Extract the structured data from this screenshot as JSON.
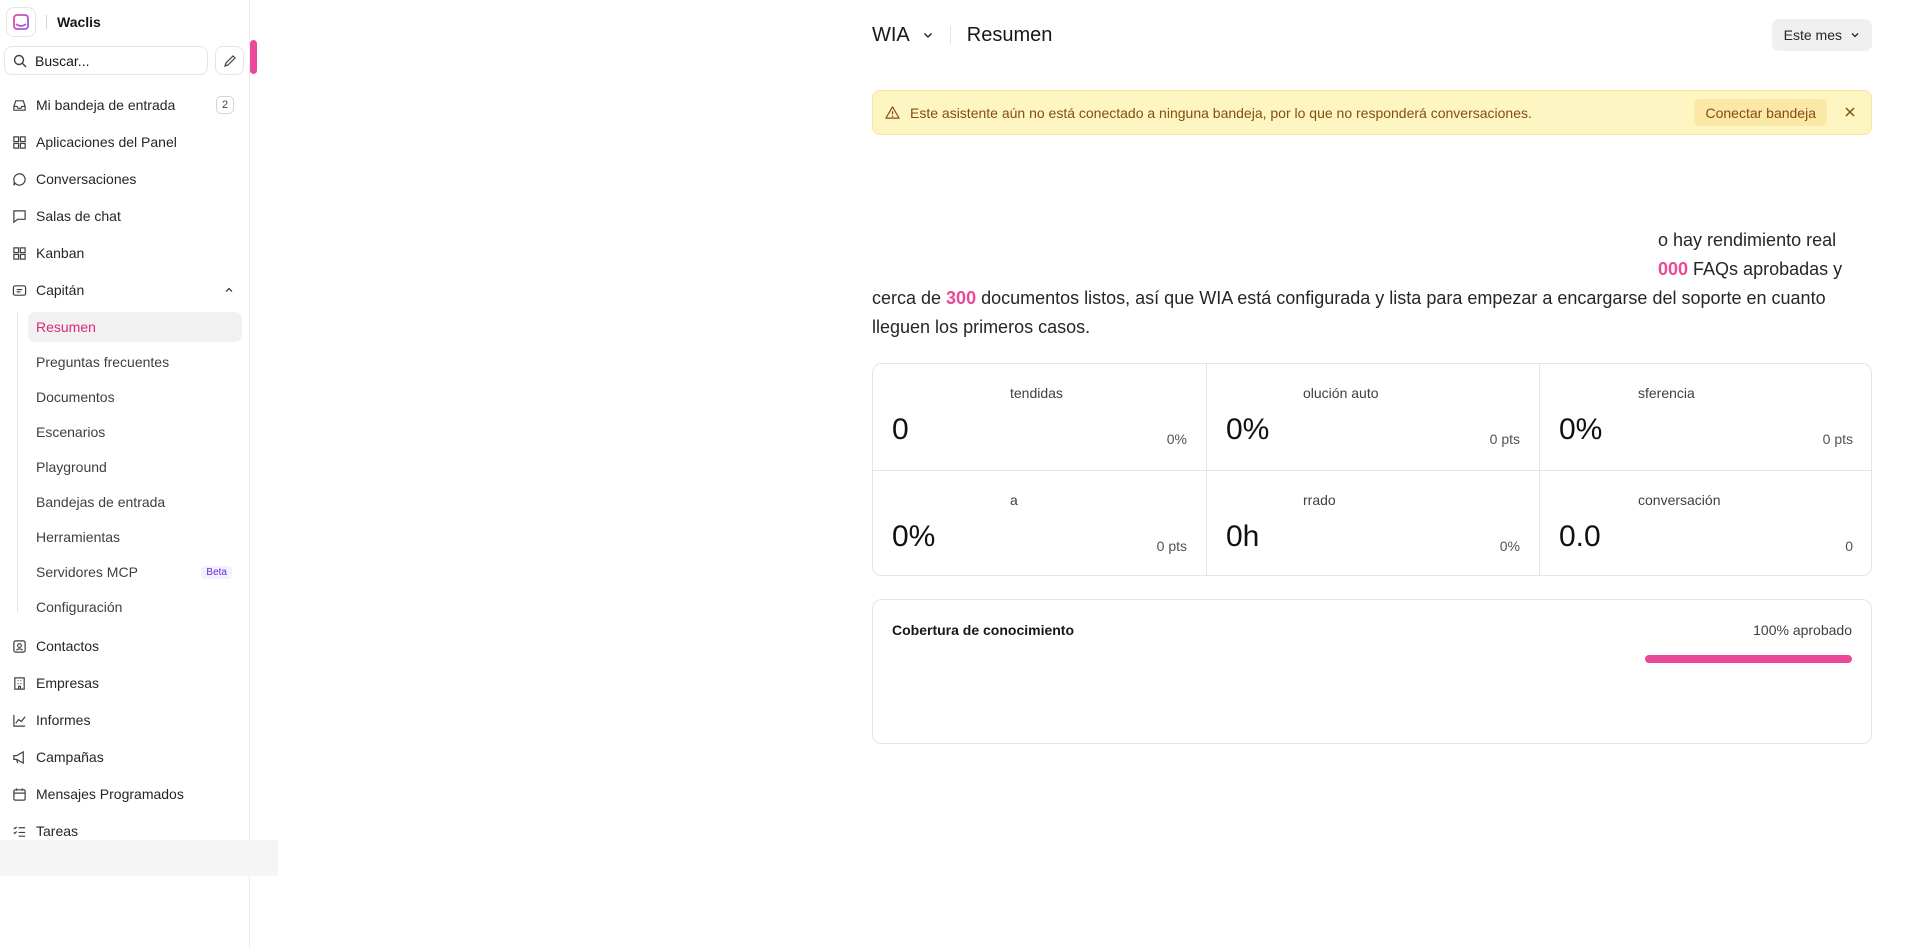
{
  "brand": {
    "name": "Waclis"
  },
  "search": {
    "placeholder": "Buscar..."
  },
  "nav": {
    "inbox": {
      "label": "Mi bandeja de entrada",
      "count": "2"
    },
    "dashboard_apps": "Aplicaciones del Panel",
    "conversations": "Conversaciones",
    "chat_rooms": "Salas de chat",
    "kanban": "Kanban",
    "captain": "Capitán",
    "captain_items": [
      "Resumen",
      "Preguntas frecuentes",
      "Documentos",
      "Escenarios",
      "Playground",
      "Bandejas de entrada",
      "Herramientas",
      "Servidores MCP",
      "Configuración"
    ],
    "beta_label": "Beta",
    "contacts": "Contactos",
    "companies": "Empresas",
    "reports": "Informes",
    "campaigns": "Campañas",
    "scheduled_messages": "Mensajes Programados",
    "tasks": "Tareas"
  },
  "header": {
    "assistant": "WIA",
    "title": "Resumen",
    "period": "Este mes"
  },
  "alert": {
    "text": "Este asistente aún no está conectado a ninguna bandeja, por lo que no responderá conversaciones.",
    "action": "Conectar bandeja"
  },
  "intro": {
    "line1": "o hay rendimiento real",
    "highlight1": "000",
    "line2_rest": " FAQs aprobadas y",
    "line3_start": "cerca de ",
    "highlight2": "300",
    "line3_rest": " documentos listos, así que WIA está configurada y lista para empezar a encargarse del soporte en cuanto",
    "line4": "lleguen los primeros casos."
  },
  "metrics": [
    {
      "label": "tendidas",
      "value": "0",
      "delta": "0%"
    },
    {
      "label": "olución auto",
      "value": "0%",
      "delta": "0 pts"
    },
    {
      "label": "sferencia",
      "value": "0%",
      "delta": "0 pts"
    },
    {
      "label": "a",
      "value": "0%",
      "delta": "0 pts"
    },
    {
      "label": "rrado",
      "value": "0h",
      "delta": "0%"
    },
    {
      "label": "conversación",
      "value": "0.0",
      "delta": "0"
    }
  ],
  "coverage": {
    "title": "Cobertura de conocimiento",
    "value_label": "100% aprobado",
    "percent": 100
  },
  "colors": {
    "accent": "#ec4899",
    "alert_bg": "#fdf6c3",
    "alert_text": "#854d0e"
  }
}
